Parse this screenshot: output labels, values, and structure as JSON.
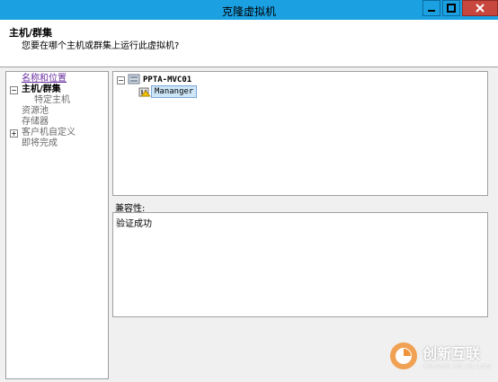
{
  "window": {
    "title": "克隆虚拟机"
  },
  "header": {
    "title": "主机/群集",
    "subtitle": "您要在哪个主机或群集上运行此虚拟机?"
  },
  "nav": {
    "items": [
      {
        "label": "名称和位置",
        "state": "link"
      },
      {
        "label": "主机/群集",
        "state": "active",
        "expander": "−"
      },
      {
        "label": "特定主机",
        "state": "muted-sub"
      },
      {
        "label": "资源池",
        "state": "muted"
      },
      {
        "label": "存储器",
        "state": "muted"
      },
      {
        "label": "客户机自定义",
        "state": "muted",
        "expander": "+"
      },
      {
        "label": "即将完成",
        "state": "muted"
      }
    ]
  },
  "tree": {
    "root": {
      "label": "PPTA-MVC01",
      "expander": "−"
    },
    "child": {
      "label": "Mananger"
    }
  },
  "compatibility": {
    "label": "兼容性:",
    "text": "验证成功"
  },
  "watermark": {
    "cn": "创新互联",
    "en": "CHUANG XIN HU LIAN"
  },
  "colors": {
    "titlebar": "#1ba1e2",
    "close": "#c7463d",
    "link": "#6a2fa0"
  }
}
